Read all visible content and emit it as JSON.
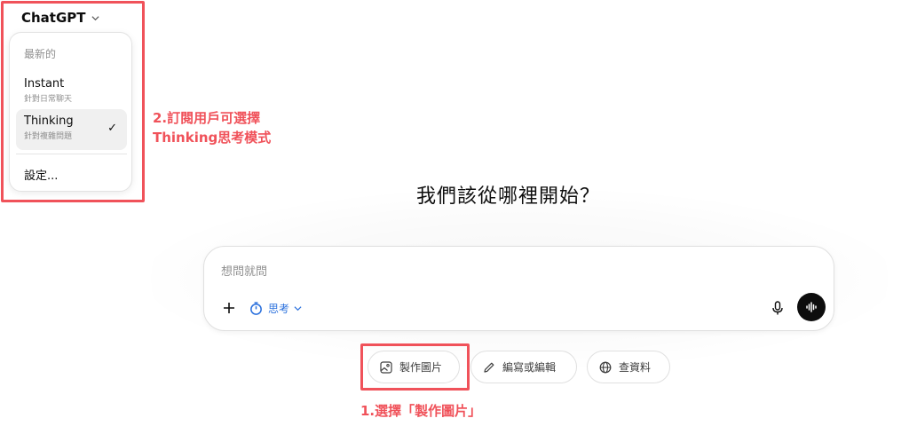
{
  "header": {
    "model_name": "ChatGPT"
  },
  "model_menu": {
    "section_label": "最新的",
    "items": [
      {
        "label": "Instant",
        "sub": "針對日常聊天",
        "selected": false
      },
      {
        "label": "Thinking",
        "sub": "針對複雜問題",
        "selected": true
      }
    ],
    "check_mark": "✓",
    "settings_label": "設定..."
  },
  "main": {
    "heading": "我們該從哪裡開始？",
    "composer": {
      "placeholder": "想問就問",
      "value": "",
      "plus_label": "+",
      "mode_label": "思考"
    },
    "suggestions": [
      {
        "label": "製作圖片",
        "icon": "image-icon"
      },
      {
        "label": "編寫或編輯",
        "icon": "pencil-icon"
      },
      {
        "label": "查資料",
        "icon": "globe-icon"
      }
    ]
  },
  "annotations": {
    "note_2_line1": "2.訂閱用戶可選擇",
    "note_2_line2": "Thinking思考模式",
    "note_1": "1.選擇「製作圖片」",
    "color": "#f0525a"
  },
  "colors": {
    "accent_blue": "#2a70dd",
    "text": "#0d0d0d",
    "annotation": "#f0525a"
  }
}
